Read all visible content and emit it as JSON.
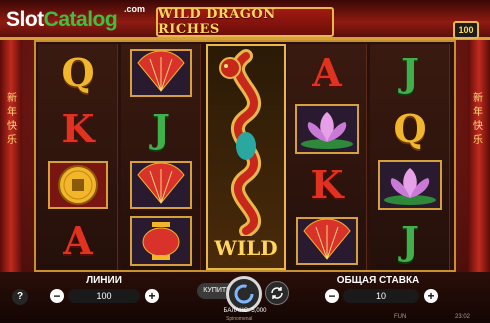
{
  "watermark": {
    "part1": "Slot",
    "part2": "Catalog",
    "suffix": ".com"
  },
  "game_title": "WILD DRAGON RICHES",
  "badge_value": "100",
  "side_text_left": "新年快乐",
  "side_text_right": "新年快乐",
  "reels": [
    [
      {
        "symbol": "Q",
        "kind": "letter",
        "color": "gold"
      },
      {
        "symbol": "K",
        "kind": "letter",
        "color": "red"
      },
      {
        "symbol": "gold-coin",
        "kind": "icon"
      },
      {
        "symbol": "A",
        "kind": "letter",
        "color": "red"
      }
    ],
    [
      {
        "symbol": "fan",
        "kind": "icon"
      },
      {
        "symbol": "J",
        "kind": "letter",
        "color": "green"
      },
      {
        "symbol": "fan",
        "kind": "icon"
      },
      {
        "symbol": "lantern",
        "kind": "icon"
      }
    ],
    [
      {
        "symbol": "dragon-wild",
        "kind": "expanded-wild"
      }
    ],
    [
      {
        "symbol": "A",
        "kind": "letter",
        "color": "red"
      },
      {
        "symbol": "lotus",
        "kind": "icon"
      },
      {
        "symbol": "K",
        "kind": "letter",
        "color": "red"
      },
      {
        "symbol": "fan",
        "kind": "icon"
      }
    ],
    [
      {
        "symbol": "J",
        "kind": "letter",
        "color": "green"
      },
      {
        "symbol": "Q",
        "kind": "letter",
        "color": "gold"
      },
      {
        "symbol": "lotus",
        "kind": "icon"
      },
      {
        "symbol": "J",
        "kind": "letter",
        "color": "green"
      }
    ]
  ],
  "wild_label": "WILD",
  "controls": {
    "help_label": "?",
    "lines_label": "ЛИНИИ",
    "lines_value": "100",
    "buy_label": "КУПИТЬ",
    "stake_label": "ОБЩАЯ СТАВКА",
    "stake_value": "10",
    "minus": "−",
    "plus": "+",
    "balance_text": "БАЛАНС: 5,000",
    "provider_text": "Spinomenal",
    "fun_text": "FUN",
    "clock_text": "23:02"
  },
  "colors": {
    "accent_gold": "#e8b84a",
    "watermark_green": "#3fbf3f",
    "red": "#e0321f",
    "green": "#3fb04a",
    "gold": "#f2b62a"
  }
}
